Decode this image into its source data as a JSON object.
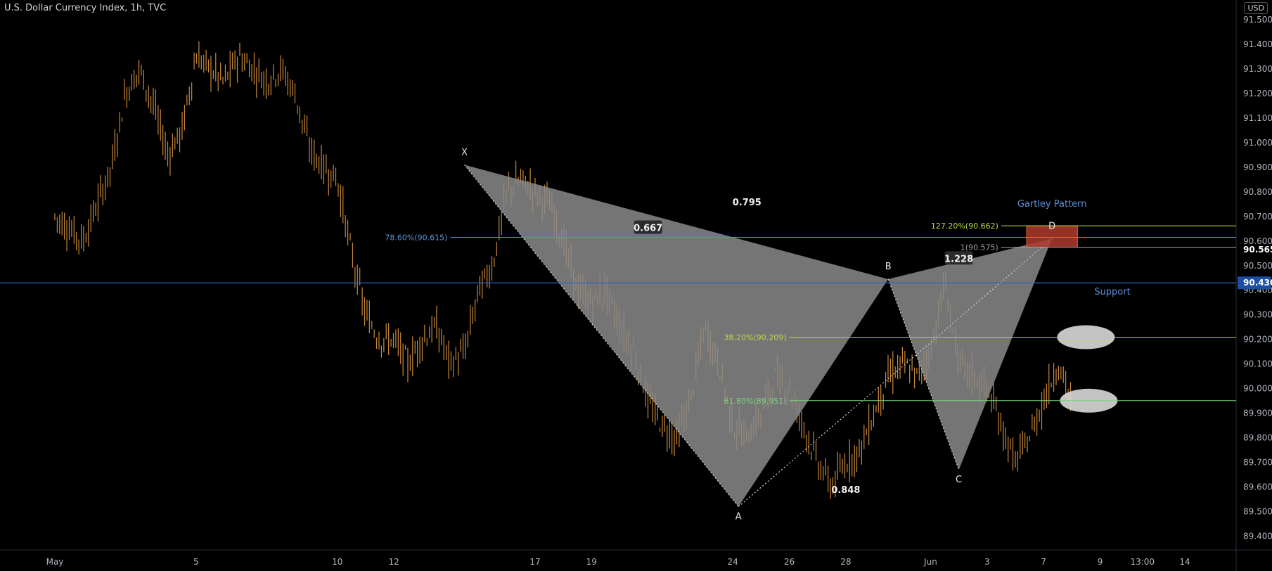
{
  "header": {
    "title": "U.S. Dollar Currency Index, 1h, TVC",
    "currency_badge": "USD"
  },
  "colors": {
    "candle": "#c8883a",
    "pattern_fill": "#8a8a8a",
    "fib_green": "#b7d94c",
    "fib_grey": "#9e9e9e",
    "support_blue": "#2f63c9",
    "label_blue": "#5b8fd6",
    "target_box": "#b03a2e",
    "price_tag": "#1e4fa6"
  },
  "chart_data": {
    "type": "candlestick",
    "x_tick_labels": [
      "May",
      "5",
      "10",
      "12",
      "17",
      "19",
      "24",
      "26",
      "28",
      "Jun",
      "3",
      "7",
      "9",
      "13:00",
      "14"
    ],
    "y_axis": {
      "ylim": [
        89.35,
        91.58
      ],
      "tick_labels": [
        "91.500",
        "91.400",
        "91.300",
        "91.200",
        "91.100",
        "91.000",
        "90.900",
        "90.800",
        "90.700",
        "90.600",
        "90.500",
        "90.400",
        "90.300",
        "90.200",
        "90.100",
        "90.000",
        "89.900",
        "89.800",
        "89.700",
        "89.600",
        "89.500",
        "89.400"
      ],
      "tick_values": [
        91.5,
        91.4,
        91.3,
        91.2,
        91.1,
        91.0,
        90.9,
        90.8,
        90.7,
        90.6,
        90.5,
        90.4,
        90.3,
        90.2,
        90.1,
        90.0,
        89.9,
        89.8,
        89.7,
        89.6,
        89.5,
        89.4
      ]
    },
    "price_path_days": [
      0,
      0.5,
      1,
      1.5,
      2,
      2.5,
      3,
      3.5,
      4,
      4.5,
      5,
      5.5,
      6,
      6.5,
      7,
      7.5,
      8,
      8.5,
      9,
      9.5,
      10,
      10.5,
      11,
      11.5,
      12,
      12.5,
      13,
      13.5,
      14,
      14.5,
      15,
      15.5,
      16,
      16.5,
      17,
      17.5,
      18,
      18.5,
      19,
      19.5,
      20,
      20.5,
      21,
      21.5,
      22,
      22.5,
      23,
      23.5,
      24,
      24.5,
      25,
      25.5,
      26,
      26.5,
      27,
      27.5,
      28,
      28.5,
      29,
      29.5,
      30,
      30.5,
      31,
      31.5,
      32,
      32.5,
      33,
      33.5,
      34,
      34.5,
      35,
      35.5,
      36,
      36.5,
      37,
      37.5,
      38,
      38.5,
      39,
      39.5,
      40
    ],
    "price_path_values": [
      90.7,
      90.65,
      90.6,
      90.75,
      90.9,
      91.2,
      91.3,
      91.15,
      90.95,
      91.05,
      91.35,
      91.3,
      91.25,
      91.35,
      91.3,
      91.25,
      91.3,
      91.2,
      90.98,
      90.9,
      90.85,
      90.55,
      90.3,
      90.2,
      90.2,
      90.1,
      90.2,
      90.25,
      90.1,
      90.15,
      90.4,
      90.5,
      90.8,
      90.85,
      90.8,
      90.75,
      90.6,
      90.4,
      90.35,
      90.4,
      90.25,
      90.15,
      89.95,
      89.85,
      89.8,
      89.95,
      90.25,
      90.1,
      89.85,
      89.8,
      89.9,
      90.05,
      90.0,
      89.85,
      89.7,
      89.6,
      89.7,
      89.75,
      89.9,
      90.05,
      90.1,
      90.05,
      90.15,
      90.43,
      90.1,
      90.05,
      90.0,
      89.85,
      89.7,
      89.8,
      89.95,
      90.1,
      89.95,
      89.9,
      90.0,
      90.5,
      90.55,
      90.6,
      90.57,
      90.55,
      90.5
    ],
    "x_tick_days": [
      0,
      5,
      10,
      12,
      17,
      19,
      24,
      26,
      28,
      31,
      33,
      35,
      37,
      38.5,
      40
    ],
    "harmonic_points": [
      {
        "label": "X",
        "day": 14.5,
        "price": 90.91
      },
      {
        "label": "A",
        "day": 24.2,
        "price": 89.52
      },
      {
        "label": "B",
        "day": 29.5,
        "price": 90.445
      },
      {
        "label": "C",
        "day": 32.0,
        "price": 89.67
      },
      {
        "label": "D",
        "day": 35.3,
        "price": 90.61
      }
    ],
    "ratios": [
      {
        "text": "0.667",
        "day": 21.0,
        "price": 90.655,
        "boxed": true
      },
      {
        "text": "0.795",
        "day": 24.5,
        "price": 90.76,
        "boxed": false
      },
      {
        "text": "1.228",
        "day": 32.0,
        "price": 90.53,
        "boxed": true
      },
      {
        "text": "0.848",
        "day": 28.0,
        "price": 89.59,
        "boxed": false
      }
    ],
    "fib_levels": [
      {
        "label": "127.20%(90.662)",
        "price": 90.662,
        "color": "#b7d94c",
        "x1_day": 33.5,
        "x2_day": 40
      },
      {
        "label": "1(90.575)",
        "price": 90.575,
        "color": "#9e9e9e",
        "x1_day": 33.5,
        "x2_day": 40
      },
      {
        "label": "78.60%(90.615)",
        "price": 90.615,
        "color": "#5b8fd6",
        "x1_day": 14.0,
        "x2_day": 40
      },
      {
        "label": "38.20%(90.209)",
        "price": 90.209,
        "color": "#b7d94c",
        "x1_day": 26.0,
        "x2_day": 40
      },
      {
        "label": "61.80%(89.951)",
        "price": 89.951,
        "color": "#7fd07f",
        "x1_day": 26.0,
        "x2_day": 40
      }
    ],
    "support": {
      "label": "Support",
      "price": 90.43
    },
    "pattern_label": "Gartley Pattern",
    "price_tags": [
      {
        "text": "90.565",
        "price": 90.565,
        "style": "plain"
      },
      {
        "text": "90.430",
        "price": 90.43,
        "style": "blue"
      }
    ],
    "target_zone": {
      "day1": 34.4,
      "day2": 36.2,
      "price_low": 90.575,
      "price_high": 90.662
    },
    "ellipses": [
      {
        "day": 36.5,
        "price": 90.209
      },
      {
        "day": 36.6,
        "price": 89.951
      }
    ]
  }
}
